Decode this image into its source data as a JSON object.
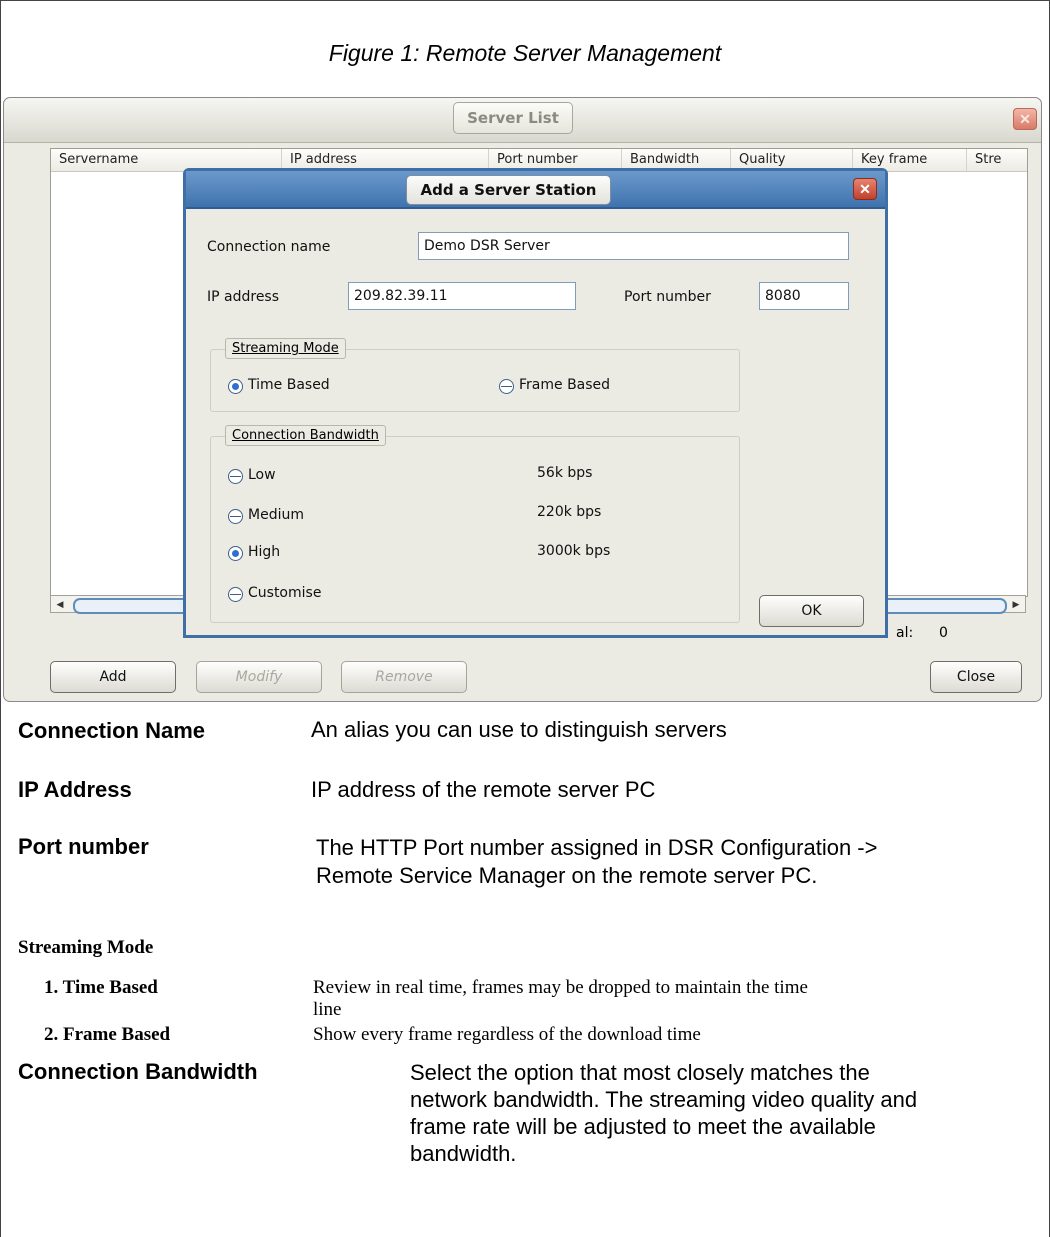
{
  "figure_caption": "Figure 1: Remote Server Management",
  "server_list": {
    "title": "Server List",
    "columns": [
      "Servername",
      "IP address",
      "Port number",
      "Bandwidth",
      "Quality",
      "Key frame",
      "Stre"
    ],
    "total_label": "al:",
    "total_value": "0",
    "buttons": {
      "add": "Add",
      "modify": "Modify",
      "remove": "Remove",
      "close": "Close"
    }
  },
  "dialog": {
    "title": "Add a Server Station",
    "connection_name_label": "Connection name",
    "connection_name_value": "Demo DSR Server",
    "ip_label": "IP address",
    "ip_value": "209.82.39.11",
    "port_label": "Port number",
    "port_value": "8080",
    "streaming_mode": {
      "legend": "Streaming Mode",
      "options": [
        {
          "label": "Time Based",
          "checked": true
        },
        {
          "label": "Frame Based",
          "checked": false
        }
      ]
    },
    "bandwidth": {
      "legend": "Connection Bandwidth",
      "options": [
        {
          "label": "Low",
          "rate": "56k bps",
          "checked": false
        },
        {
          "label": "Medium",
          "rate": "220k bps",
          "checked": false
        },
        {
          "label": "High",
          "rate": "3000k bps",
          "checked": true
        },
        {
          "label": "Customise",
          "rate": "",
          "checked": false
        }
      ]
    },
    "ok_label": "OK"
  },
  "definitions": {
    "connection_name": {
      "term": "Connection Name",
      "desc": "An alias you can use to distinguish servers"
    },
    "ip_address": {
      "term": "IP Address",
      "desc": "IP address of the remote server PC"
    },
    "port_number": {
      "term": "Port number",
      "desc_line1": "The HTTP Port number assigned in DSR Configuration ->",
      "desc_line2": "Remote Service Manager on the remote server PC."
    },
    "streaming_mode": {
      "heading": "Streaming Mode",
      "item1_term": "1. Time Based",
      "item1_desc_line1": "Review in real time, frames may be dropped to maintain the time",
      "item1_desc_line2": "line",
      "item2_term": "2. Frame Based",
      "item2_desc": "Show every frame regardless of the download time"
    },
    "connection_bandwidth": {
      "term": "Connection Bandwidth",
      "desc_line1": "Select the option that most closely matches the",
      "desc_line2": "network bandwidth. The streaming video quality and",
      "desc_line3": "frame rate will be adjusted to meet the available",
      "desc_line4": "bandwidth."
    }
  }
}
